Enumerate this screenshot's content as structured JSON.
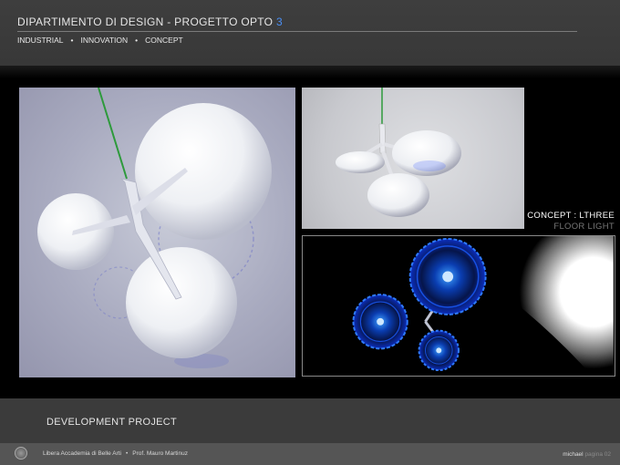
{
  "header": {
    "title": "DIPARTIMENTO DI DESIGN  -  PROGETTO OPTO",
    "title_number": "3",
    "tags": [
      "INDUSTRIAL",
      "INNOVATION",
      "CONCEPT"
    ]
  },
  "concept": {
    "title": "CONCEPT :  LTHREE",
    "subtitle": "FLOOR LIGHT"
  },
  "band": {
    "label": "DEVELOPMENT PROJECT"
  },
  "footer": {
    "institution": "Libera Accademia di Belle Arti",
    "professor": "Prof. Mauro Martinuz",
    "author": "michael",
    "page_note": "pagina 02"
  },
  "images": [
    {
      "name": "render-main",
      "subject": "three white sphere lamp render, perspective view"
    },
    {
      "name": "render-side",
      "subject": "three white sphere lamp render, side view"
    },
    {
      "name": "render-top-lit",
      "subject": "lamp from below with blue glowing shades"
    }
  ],
  "colors": {
    "accent": "#4a8ef2",
    "glow": "#1a5cff",
    "cable": "#2e9a3c"
  }
}
